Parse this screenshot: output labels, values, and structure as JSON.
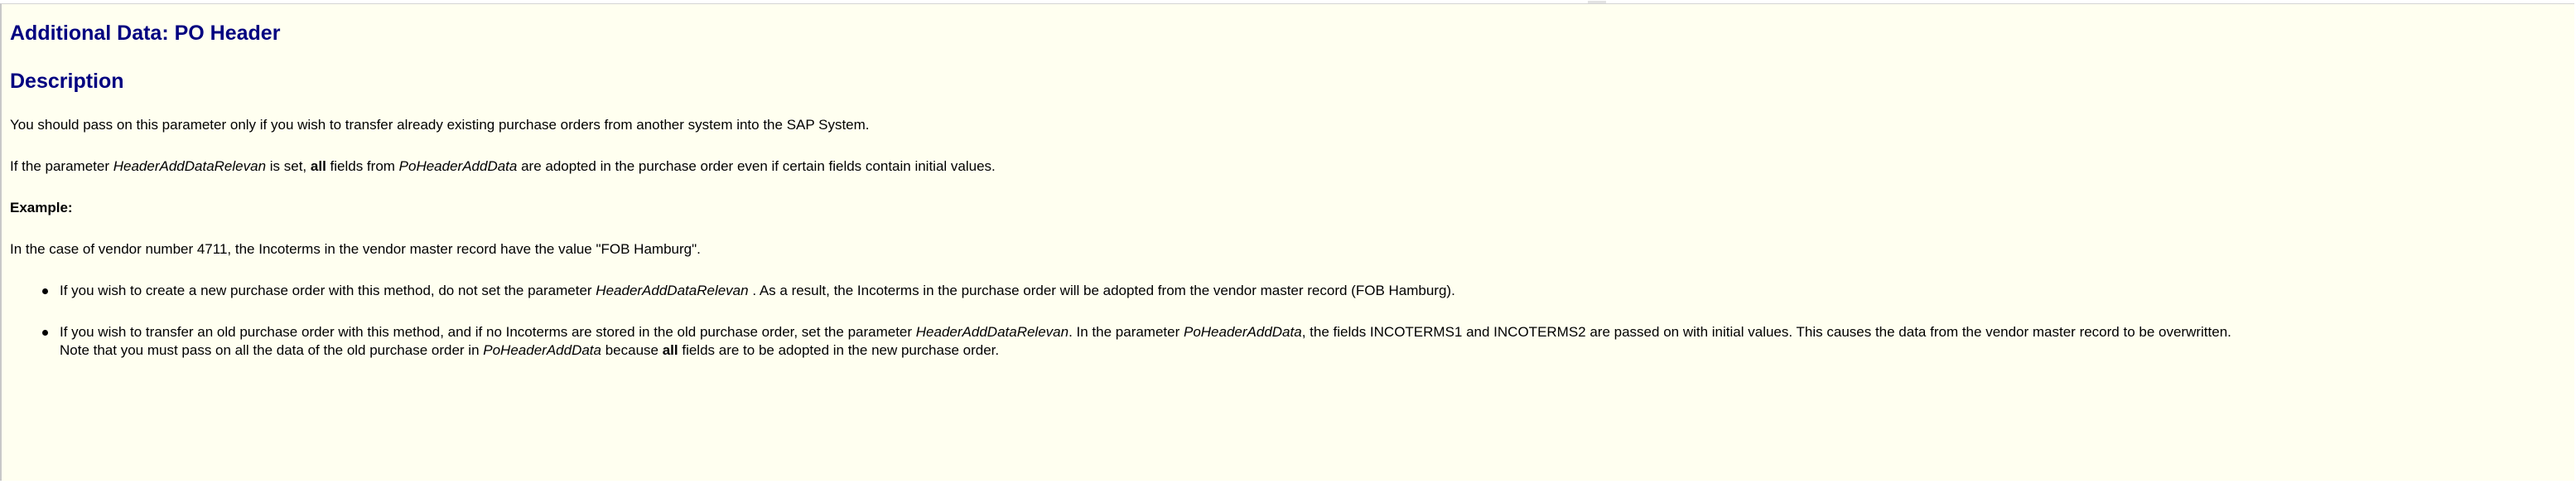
{
  "doc": {
    "title": "Additional Data: PO Header",
    "section_heading": "Description",
    "para1": "You should pass on this parameter only if you wish to transfer already existing purchase orders from another system into the SAP System.",
    "para2": {
      "a": "If the parameter ",
      "b": "HeaderAddDataRelevan",
      "c": " is set, ",
      "d": "all",
      "e": " fields from ",
      "f": "PoHeaderAddData",
      "g": " are adopted in the purchase order even if certain fields contain initial values."
    },
    "example_label": "Example:",
    "para3": "In the case of vendor number 4711, the Incoterms in the vendor master record have the value \"FOB Hamburg\".",
    "bullet1": {
      "a": "If you wish to create a new purchase order with this method, do not set the parameter ",
      "b": "HeaderAddDataRelevan",
      "c": " . As a result, the Incoterms in the purchase order will be adopted from the vendor master record (FOB Hamburg)."
    },
    "bullet2": {
      "a": "If you wish to transfer an old purchase order with this method, and if no Incoterms are stored in the old purchase order, set the parameter ",
      "b": "HeaderAddDataRelevan",
      "c": ". In the parameter ",
      "d": "PoHeaderAddData",
      "e": ", the fields INCOTERMS1 and INCOTERMS2 are passed on with initial values. This causes the data from the vendor master record to be overwritten.",
      "f": "Note that you must pass on all the data of the old purchase order in ",
      "g": "PoHeaderAddData",
      "h": " because ",
      "i": "all",
      "j": " fields are to be adopted in the new purchase order."
    }
  }
}
